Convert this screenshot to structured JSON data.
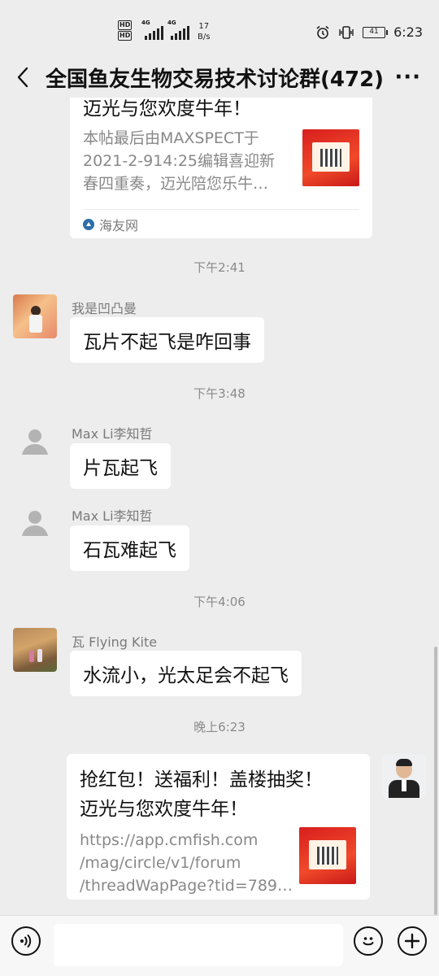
{
  "status": {
    "hd1": "HD",
    "hd2": "HD",
    "net1": "4G",
    "net2": "4G",
    "speed_value": "17",
    "speed_unit": "B/s",
    "battery": "41",
    "time": "6:23"
  },
  "header": {
    "title": "全国鱼友生物交易技术讨论群(472)",
    "more": "···"
  },
  "messages": {
    "card1": {
      "title": "迈光与您欢度牛年！",
      "desc_lines": [
        "本帖最后由MAXSPECT于",
        "2021-2-914:25编辑喜迎新",
        "春四重奏，迈光陪您乐牛…"
      ],
      "source": "海友网"
    },
    "time1": "下午2:41",
    "m1": {
      "sender": "我是凹凸曼",
      "text": "瓦片不起飞是咋回事"
    },
    "time2": "下午3:48",
    "m2": {
      "sender": "Max Li李知哲",
      "text": "片瓦起飞"
    },
    "m3": {
      "sender": "Max Li李知哲",
      "text": "石瓦难起飞"
    },
    "time3": "下午4:06",
    "m4": {
      "sender": "瓦 Flying Kite",
      "text": "水流小，光太足会不起飞"
    },
    "time4": "晚上6:23",
    "card2": {
      "title_lines": [
        "抢红包！送福利！盖楼抽奖！",
        "迈光与您欢度牛年！"
      ],
      "desc_lines": [
        "https://app.cmfish.com",
        "/mag/circle/v1/forum",
        "/threadWapPage?tid=789…"
      ]
    }
  },
  "colors": {
    "background": "#ededed",
    "bubble": "#ffffff",
    "accent_red": "#d81e1e"
  }
}
